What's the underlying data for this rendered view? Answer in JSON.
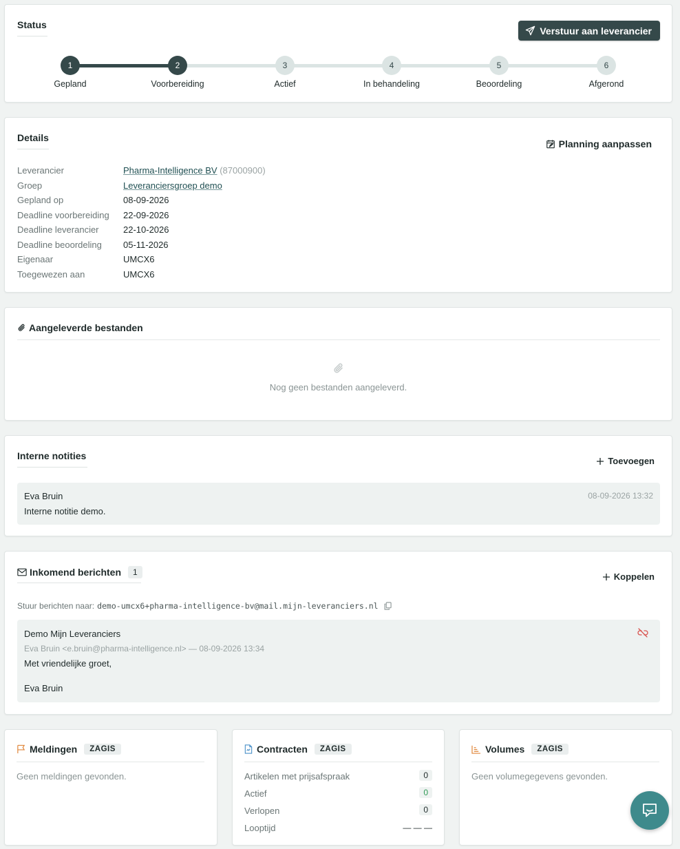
{
  "status": {
    "title": "Status",
    "send_button": "Verstuur aan leverancier",
    "steps": [
      {
        "num": "1",
        "label": "Gepland"
      },
      {
        "num": "2",
        "label": "Voorbereiding"
      },
      {
        "num": "3",
        "label": "Actief"
      },
      {
        "num": "4",
        "label": "In behandeling"
      },
      {
        "num": "5",
        "label": "Beoordeling"
      },
      {
        "num": "6",
        "label": "Afgerond"
      }
    ],
    "current_step": 2
  },
  "details": {
    "title": "Details",
    "planning_button": "Planning aanpassen",
    "rows": [
      {
        "label": "Leverancier",
        "value": "Pharma-Intelligence BV",
        "extra": "(87000900)"
      },
      {
        "label": "Groep",
        "value": "Leveranciersgroep demo"
      },
      {
        "label": "Gepland op",
        "value": "08-09-2026"
      },
      {
        "label": "Deadline voorbereiding",
        "value": "22-09-2026"
      },
      {
        "label": "Deadline leverancier",
        "value": "22-10-2026"
      },
      {
        "label": "Deadline beoordeling",
        "value": "05-11-2026"
      },
      {
        "label": "Eigenaar",
        "value": "UMCX6"
      },
      {
        "label": "Toegewezen aan",
        "value": "UMCX6"
      }
    ]
  },
  "files": {
    "title": "Aangeleverde bestanden",
    "empty_text": "Nog geen bestanden aangeleverd."
  },
  "notes": {
    "title": "Interne notities",
    "add_button": "Toevoegen",
    "items": [
      {
        "author": "Eva Bruin",
        "timestamp": "08-09-2026 13:32",
        "text": "Interne notitie demo."
      }
    ]
  },
  "messages": {
    "title": "Inkomend berichten",
    "count": "1",
    "link_button": "Koppelen",
    "send_to_label": "Stuur berichten naar:",
    "send_to_address": "demo-umcx6+pharma-intelligence-bv@mail.mijn-leveranciers.nl",
    "items": [
      {
        "subject": "Demo Mijn Leveranciers",
        "meta": "Eva Bruin <e.bruin@pharma-intelligence.nl> — 08-09-2026 13:34",
        "body_line1": "Met vriendelijke groet,",
        "body_line2": "Eva Bruin"
      }
    ]
  },
  "meldingen": {
    "title": "Meldingen",
    "tag": "ZAGIS",
    "empty_text": "Geen meldingen gevonden."
  },
  "contracten": {
    "title": "Contracten",
    "tag": "ZAGIS",
    "rows": [
      {
        "label": "Artikelen met prijsafspraak",
        "value": "0"
      },
      {
        "label": "Actief",
        "value": "0"
      },
      {
        "label": "Verlopen",
        "value": "0"
      },
      {
        "label": "Looptijd",
        "value": "— — —"
      }
    ]
  },
  "volumes": {
    "title": "Volumes",
    "tag": "ZAGIS",
    "empty_text": "Geen volumegegevens gevonden."
  },
  "colors": {
    "primary": "#35494a",
    "accent_teal": "#3e8a8c",
    "icon_orange": "#e0863a",
    "icon_blue": "#4a90c8",
    "unlink_red": "#d9534f",
    "positive_green": "#2f9a55"
  },
  "icons": {
    "send": "paper-plane-icon",
    "calendar": "calendar-edit-icon",
    "attachment": "paperclip-icon",
    "plus": "plus-icon",
    "mail": "envelope-icon",
    "copy": "copy-icon",
    "unlink": "unlink-icon",
    "flag": "flag-icon",
    "document": "document-icon",
    "chart": "bar-chart-icon",
    "chat": "chat-bubble-icon"
  }
}
